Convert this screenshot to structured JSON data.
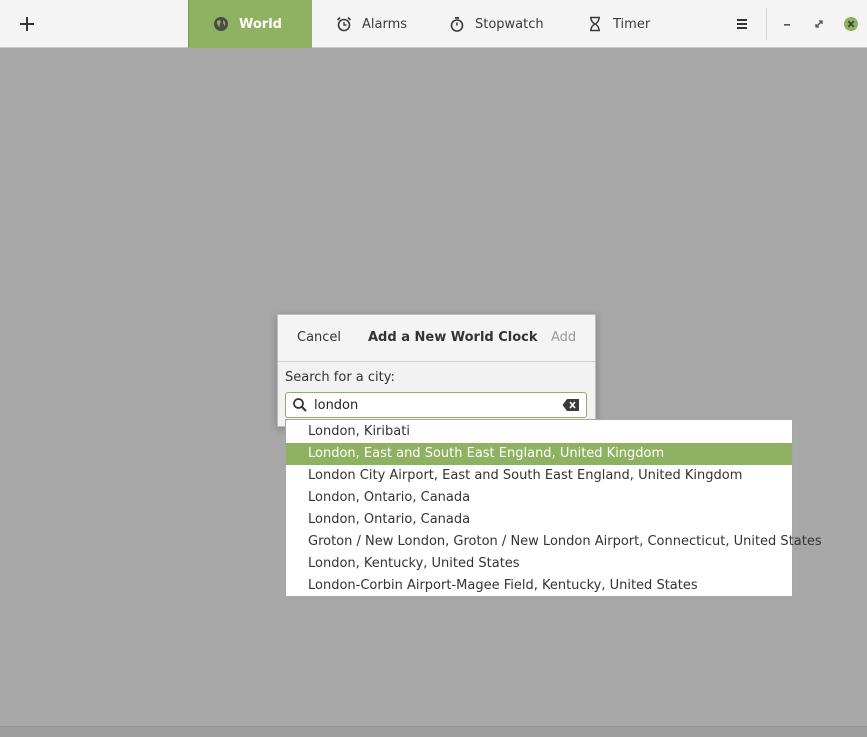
{
  "header": {
    "tabs": [
      {
        "label": "World",
        "icon": "globe-icon",
        "active": true
      },
      {
        "label": "Alarms",
        "icon": "alarm-clock-icon"
      },
      {
        "label": "Stopwatch",
        "icon": "stopwatch-icon"
      },
      {
        "label": "Timer",
        "icon": "hourglass-icon"
      }
    ]
  },
  "dialog": {
    "cancel_label": "Cancel",
    "title": "Add a New World Clock",
    "add_label": "Add",
    "search_label": "Search for a city:",
    "search_value": "london"
  },
  "suggestions": [
    "London, Kiribati",
    "London, East and South East England, United Kingdom",
    "London City Airport, East and South East England, United Kingdom",
    "London, Ontario, Canada",
    "London, Ontario, Canada",
    "Groton / New London, Groton / New London Airport, Connecticut, United States",
    "London, Kentucky, United States",
    "London-Corbin Airport-Magee Field, Kentucky, United States"
  ],
  "selected_suggestion_index": 1,
  "colors": {
    "accent": "#8fb162",
    "backdrop": "#a8a8a8"
  }
}
